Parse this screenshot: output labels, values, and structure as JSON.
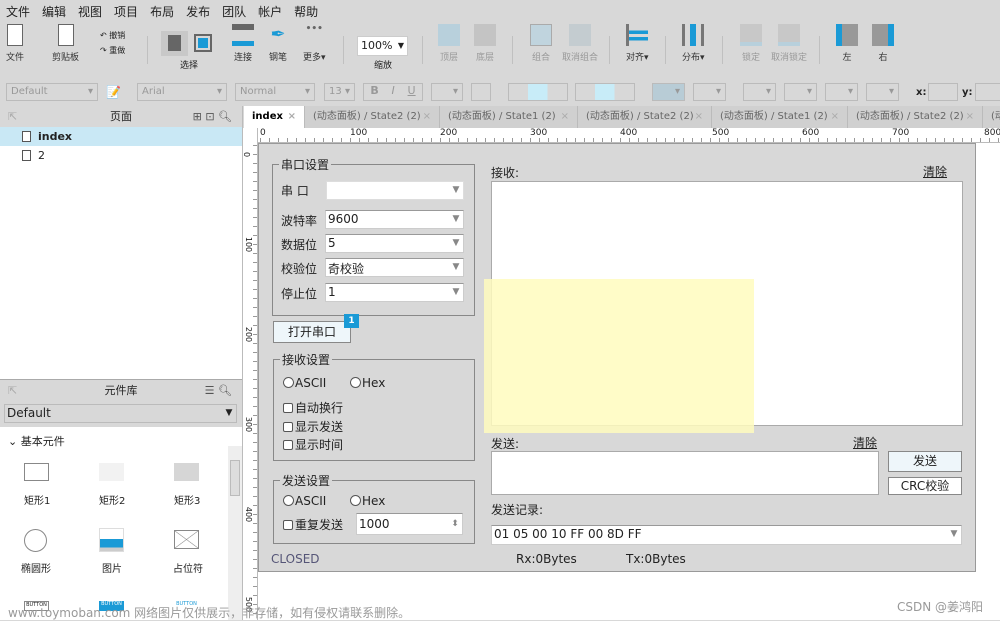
{
  "menu": [
    "文件",
    "编辑",
    "视图",
    "项目",
    "布局",
    "发布",
    "团队",
    "帐户",
    "帮助"
  ],
  "toolbar": {
    "file": "文件",
    "clipboard": "剪贴板",
    "undo": "撤销",
    "redo": "重做",
    "select": "选择",
    "connect": "连接",
    "pen": "钢笔",
    "more": "更多▾",
    "zoom": "100%",
    "zoom_label": "缩放",
    "top": "顶层",
    "bottom": "底层",
    "group": "组合",
    "ungroup": "取消组合",
    "align": "对齐▾",
    "distribute": "分布▾",
    "lock": "锁定",
    "unlock": "取消锁定",
    "left": "左",
    "right": "右"
  },
  "format": {
    "style": "Default",
    "font": "Arial",
    "weight": "Normal",
    "size": "13",
    "x_label": "x:",
    "y_label": "y:"
  },
  "pages": {
    "title": "页面",
    "items": [
      "index",
      "2"
    ]
  },
  "library": {
    "title": "元件库",
    "selected": "Default",
    "category": "基本元件",
    "widgets": [
      "矩形1",
      "矩形2",
      "矩形3",
      "椭圆形",
      "图片",
      "占位符"
    ],
    "button_text": "BUTTON"
  },
  "tabs": [
    "index",
    "(动态面板) / State2 (2)",
    "(动态面板) / State1 (2)",
    "(动态面板) / State2 (2)",
    "(动态面板) / State1 (2)",
    "(动态面板) / State2 (2)",
    "(动"
  ],
  "ruler_h": [
    "0",
    "100",
    "200",
    "300",
    "400",
    "500",
    "600",
    "700",
    "800"
  ],
  "ruler_v": [
    "0",
    "100",
    "200",
    "300",
    "400",
    "500"
  ],
  "form": {
    "serial": {
      "title": "串口设置",
      "port_label": "串  口",
      "port": "",
      "baud_label": "波特率",
      "baud": "9600",
      "data_label": "数据位",
      "data": "5",
      "parity_label": "校验位",
      "parity": "奇校验",
      "stop_label": "停止位",
      "stop": "1"
    },
    "open_button": "打开串口",
    "badge": "1",
    "recv": {
      "title": "接收设置",
      "ascii": "ASCII",
      "hex": "Hex",
      "auto_wrap": "自动换行",
      "show_send": "显示发送",
      "show_time": "显示时间"
    },
    "send": {
      "title": "发送设置",
      "ascii": "ASCII",
      "hex": "Hex",
      "repeat": "重复发送",
      "interval": "1000"
    },
    "status": "CLOSED",
    "recv_label": "接收:",
    "clear": "清除",
    "send_label": "发送:",
    "send_button": "发送",
    "crc_button": "CRC校验",
    "history_label": "发送记录:",
    "history": "01 05 00 10 FF 00 8D FF",
    "rx": "Rx:0Bytes",
    "tx": "Tx:0Bytes"
  },
  "watermark": {
    "left": "www.toymoban.com 网络图片仅供展示，非存储，如有侵权请联系删除。",
    "right": "CSDN @姜鸿阳"
  },
  "colors": {
    "accent": "#1a9ad6",
    "selected_row": "#c9e8f5",
    "highlight": "#fffbc8"
  }
}
